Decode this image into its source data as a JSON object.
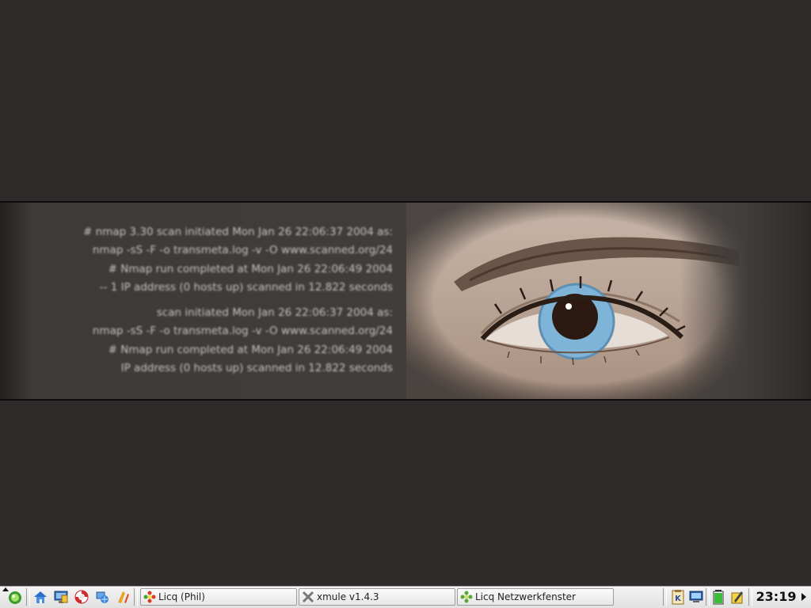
{
  "wallpaper": {
    "text_block_1": [
      "# nmap 3.30 scan initiated Mon Jan 26 22:06:37 2004 as:",
      "nmap -sS -F -o transmeta.log -v -O www.scanned.org/24",
      "# Nmap run completed at Mon Jan 26 22:06:49 2004",
      "-- 1 IP address (0 hosts up) scanned in 12.822 seconds"
    ],
    "text_block_2": [
      "scan initiated Mon Jan 26 22:06:37 2004 as:",
      "nmap -sS -F -o transmeta.log -v -O www.scanned.org/24",
      "# Nmap run completed at Mon Jan 26 22:06:49 2004",
      "IP address (0 hosts up) scanned in 12.822 seconds"
    ]
  },
  "taskbar": {
    "launchers": [
      {
        "name": "kmenu",
        "icon": "kde-menu-icon"
      },
      {
        "name": "home",
        "icon": "home-folder-icon"
      },
      {
        "name": "desktop",
        "icon": "show-desktop-icon"
      },
      {
        "name": "help",
        "icon": "help-lifebuoy-icon"
      },
      {
        "name": "network",
        "icon": "network-browser-icon"
      },
      {
        "name": "office",
        "icon": "office-tools-icon"
      }
    ],
    "tasks": [
      {
        "label": "Licq (Phil)",
        "icon": "licq-flower-icon"
      },
      {
        "label": "xmule v1.4.3",
        "icon": "xmule-x-icon"
      },
      {
        "label": "Licq Netzwerkfenster",
        "icon": "licq-green-icon"
      }
    ],
    "tray": [
      {
        "name": "klipper",
        "icon": "klipper-icon"
      },
      {
        "name": "network-monitor",
        "icon": "monitor-icon"
      },
      {
        "name": "battery",
        "icon": "battery-icon"
      },
      {
        "name": "notes",
        "icon": "notes-icon"
      }
    ],
    "clock": "23:19"
  },
  "colors": {
    "background": "#2e2b2a",
    "iris": "#7fb4d9",
    "taskbar": "#e8e8e8"
  }
}
